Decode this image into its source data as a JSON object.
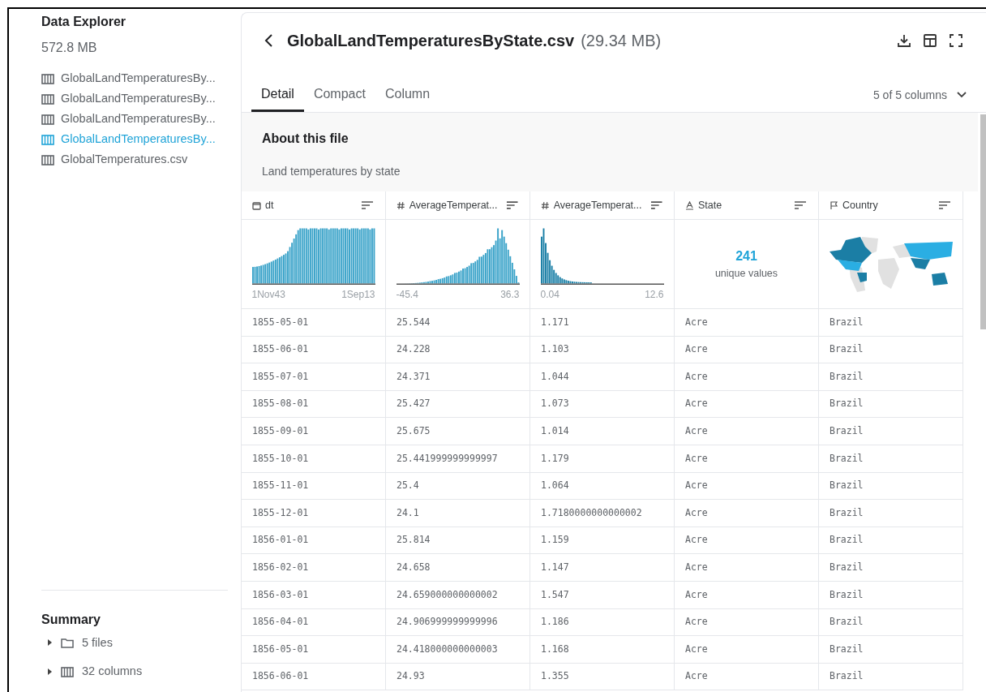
{
  "sidebar": {
    "title": "Data Explorer",
    "size": "572.8 MB",
    "files": [
      {
        "name": "GlobalLandTemperaturesBy...",
        "selected": false
      },
      {
        "name": "GlobalLandTemperaturesBy...",
        "selected": false
      },
      {
        "name": "GlobalLandTemperaturesBy...",
        "selected": false
      },
      {
        "name": "GlobalLandTemperaturesBy...",
        "selected": true
      },
      {
        "name": "GlobalTemperatures.csv",
        "selected": false
      }
    ],
    "summary": {
      "title": "Summary",
      "items": [
        {
          "kind": "folder",
          "label": "5 files",
          "expanded": false
        },
        {
          "kind": "columns",
          "label": "32 columns",
          "expanded": false
        }
      ]
    }
  },
  "file": {
    "title": "GlobalLandTemperaturesByState.csv",
    "size": "(29.34 MB)",
    "tabs": [
      {
        "label": "Detail",
        "selected": true
      },
      {
        "label": "Compact",
        "selected": false
      },
      {
        "label": "Column",
        "selected": false
      }
    ],
    "column_selector": "5 of 5 columns",
    "about": {
      "title": "About this file",
      "description": "Land temperatures by state"
    }
  },
  "table": {
    "columns": [
      {
        "kind": "date",
        "name": "dt"
      },
      {
        "kind": "number",
        "name": "AverageTemperat..."
      },
      {
        "kind": "number",
        "name": "AverageTemperat..."
      },
      {
        "kind": "string",
        "name": "State"
      },
      {
        "kind": "country",
        "name": "Country"
      }
    ],
    "summaries": [
      {
        "kind": "histogram",
        "min": "1Nov43",
        "max": "1Sep13"
      },
      {
        "kind": "histogram",
        "min": "-45.4",
        "max": "36.3"
      },
      {
        "kind": "histogram",
        "min": "0.04",
        "max": "12.6"
      },
      {
        "kind": "unique",
        "count": "241",
        "label": "unique values"
      },
      {
        "kind": "map"
      }
    ],
    "rows": [
      [
        "1855-05-01",
        "25.544",
        "1.171",
        "Acre",
        "Brazil"
      ],
      [
        "1855-06-01",
        "24.228",
        "1.103",
        "Acre",
        "Brazil"
      ],
      [
        "1855-07-01",
        "24.371",
        "1.044",
        "Acre",
        "Brazil"
      ],
      [
        "1855-08-01",
        "25.427",
        "1.073",
        "Acre",
        "Brazil"
      ],
      [
        "1855-09-01",
        "25.675",
        "1.014",
        "Acre",
        "Brazil"
      ],
      [
        "1855-10-01",
        "25.441999999999997",
        "1.179",
        "Acre",
        "Brazil"
      ],
      [
        "1855-11-01",
        "25.4",
        "1.064",
        "Acre",
        "Brazil"
      ],
      [
        "1855-12-01",
        "24.1",
        "1.7180000000000002",
        "Acre",
        "Brazil"
      ],
      [
        "1856-01-01",
        "25.814",
        "1.159",
        "Acre",
        "Brazil"
      ],
      [
        "1856-02-01",
        "24.658",
        "1.147",
        "Acre",
        "Brazil"
      ],
      [
        "1856-03-01",
        "24.659000000000002",
        "1.547",
        "Acre",
        "Brazil"
      ],
      [
        "1856-04-01",
        "24.906999999999996",
        "1.186",
        "Acre",
        "Brazil"
      ],
      [
        "1856-05-01",
        "24.418000000000003",
        "1.168",
        "Acre",
        "Brazil"
      ],
      [
        "1856-06-01",
        "24.93",
        "1.355",
        "Acre",
        "Brazil"
      ]
    ]
  }
}
